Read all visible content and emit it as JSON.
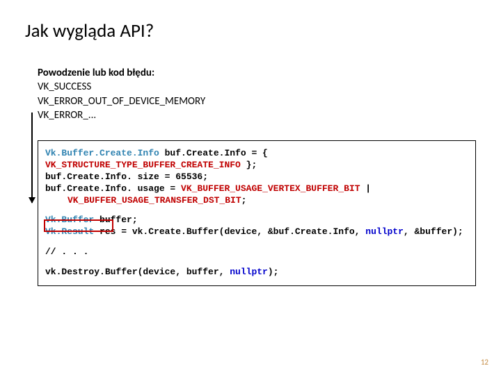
{
  "title": "Jak wygląda API?",
  "explain": {
    "line1_bold": "Powodzenie lub kod błędu:",
    "line2": "VK_SUCCESS",
    "line3": "VK_ERROR_OUT_OF_DEVICE_MEMORY",
    "line4": "VK_ERROR_..."
  },
  "code": {
    "l1_type": "Vk.Buffer.Create.Info",
    "l1_mid": " buf.Create.Info = { ",
    "l1_lit": "VK_STRUCTURE_TYPE_BUFFER_CREATE_INFO",
    "l1_end": " };",
    "l2": "buf.Create.Info. size = 65536;",
    "l3_a": "buf.Create.Info. usage = ",
    "l3_lit1": "VK_BUFFER_USAGE_VERTEX_BUFFER_BIT",
    "l3_b": " | ",
    "l4_lit": "VK_BUFFER_USAGE_TRANSFER_DST_BIT",
    "l4_b": ";",
    "l5_type": "Vk.Buffer",
    "l5_b": " buffer;",
    "l6_type": "Vk.Result",
    "l6_a": " res = vk.Create.Buffer(device, &buf.Create.Info, ",
    "l6_kw": "nullptr",
    "l6_b": ", &buffer);",
    "l7": "// . . .",
    "l8_a": "vk.Destroy.Buffer(device, buffer, ",
    "l8_kw": "nullptr",
    "l8_b": ");"
  },
  "page": "12"
}
